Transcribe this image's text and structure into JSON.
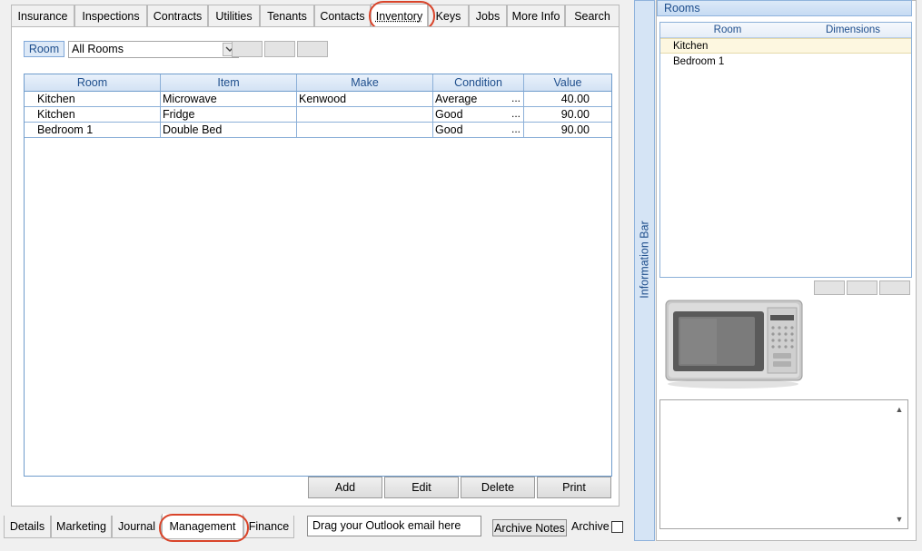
{
  "top_tabs": [
    {
      "label": "Insurance",
      "active": false
    },
    {
      "label": "Inspections",
      "active": false
    },
    {
      "label": "Contracts",
      "active": false
    },
    {
      "label": "Utilities",
      "active": false
    },
    {
      "label": "Tenants",
      "active": false
    },
    {
      "label": "Contacts",
      "active": false
    },
    {
      "label": "Inventory",
      "active": true
    },
    {
      "label": "Keys",
      "active": false
    },
    {
      "label": "Jobs",
      "active": false
    },
    {
      "label": "More Info",
      "active": false
    },
    {
      "label": "Search",
      "active": false
    }
  ],
  "filter": {
    "room_button": "Room",
    "room_select": "All Rooms"
  },
  "inventory_grid": {
    "headers": [
      "Room",
      "Item",
      "Make",
      "Condition",
      "Value"
    ],
    "rows": [
      {
        "room": "Kitchen",
        "item": "Microwave",
        "make": "Kenwood",
        "condition": "Average",
        "value": "40.00"
      },
      {
        "room": "Kitchen",
        "item": "Fridge",
        "make": "",
        "condition": "Good",
        "value": "90.00"
      },
      {
        "room": "Bedroom 1",
        "item": "Double Bed",
        "make": "",
        "condition": "Good",
        "value": "90.00"
      }
    ],
    "ellipsis": "..."
  },
  "actions": {
    "add": "Add",
    "edit": "Edit",
    "delete": "Delete",
    "print": "Print"
  },
  "bottom_tabs": [
    {
      "label": "Details",
      "active": false
    },
    {
      "label": "Marketing",
      "active": false
    },
    {
      "label": "Journal",
      "active": false
    },
    {
      "label": "Management",
      "active": true
    },
    {
      "label": "Finance",
      "active": false
    }
  ],
  "email_drop": "Drag your Outlook email here",
  "archive_notes_button": "Archive Notes",
  "archive_label": "Archive",
  "info_bar_label": "Information Bar",
  "rooms_panel": {
    "title": "Rooms",
    "headers": [
      "Room",
      "Dimensions"
    ],
    "rows": [
      {
        "room": "Kitchen",
        "dimensions": "",
        "selected": true
      },
      {
        "room": "Bedroom 1",
        "dimensions": "",
        "selected": false
      }
    ]
  },
  "colors": {
    "accent_blue": "#1e4e8c",
    "highlight_circle": "#d9442a",
    "header_fill": "#d3e2f4"
  }
}
